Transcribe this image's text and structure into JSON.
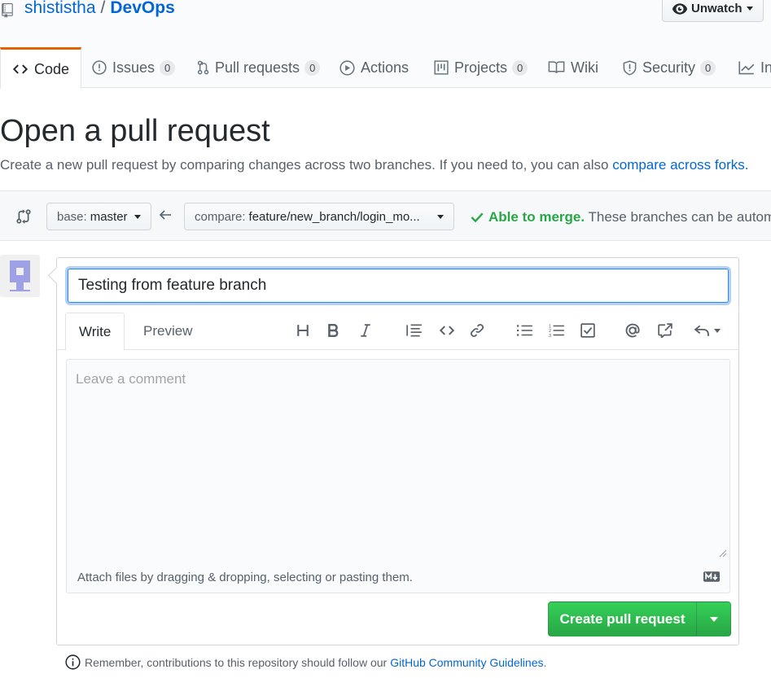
{
  "repo": {
    "owner": "shististha",
    "separator": "/",
    "name": "DevOps"
  },
  "watch": {
    "label": "Unwatch"
  },
  "tabs": [
    {
      "label": "Code",
      "icon": "code-icon"
    },
    {
      "label": "Issues",
      "count": "0",
      "icon": "issue-icon"
    },
    {
      "label": "Pull requests",
      "count": "0",
      "icon": "pull-request-icon"
    },
    {
      "label": "Actions",
      "icon": "play-icon"
    },
    {
      "label": "Projects",
      "count": "0",
      "icon": "project-icon"
    },
    {
      "label": "Wiki",
      "icon": "book-icon"
    },
    {
      "label": "Security",
      "count": "0",
      "icon": "shield-icon"
    },
    {
      "label": "In",
      "icon": "graph-icon"
    }
  ],
  "page": {
    "title": "Open a pull request",
    "subtitle": "Create a new pull request by comparing changes across two branches. If you need to, you can also",
    "subtitle_link": "compare across forks."
  },
  "range": {
    "base_label": "base:",
    "base_value": "master",
    "compare_label": "compare:",
    "compare_value": "feature/new_branch/login_mo...",
    "merge_ok": "Able to merge.",
    "merge_text": "These branches can be autom"
  },
  "form": {
    "title_value": "Testing from feature branch",
    "write_tab": "Write",
    "preview_tab": "Preview",
    "comment_placeholder": "Leave a comment",
    "attach_hint": "Attach files by dragging & dropping, selecting or pasting them.",
    "create_button": "Create pull request"
  },
  "toolbar": [
    "heading-icon",
    "bold-icon",
    "italic-icon",
    "quote-icon",
    "code-icon",
    "link-icon",
    "bulleted-list-icon",
    "numbered-list-icon",
    "task-list-icon",
    "mention-icon",
    "cross-reference-icon",
    "reply-icon"
  ],
  "footer": {
    "text": "Remember, contributions to this repository should follow our",
    "link": "GitHub Community Guidelines",
    "period": "."
  },
  "colors": {
    "link": "#0366d6",
    "success": "#28a745",
    "tab_accent": "#e36209"
  }
}
